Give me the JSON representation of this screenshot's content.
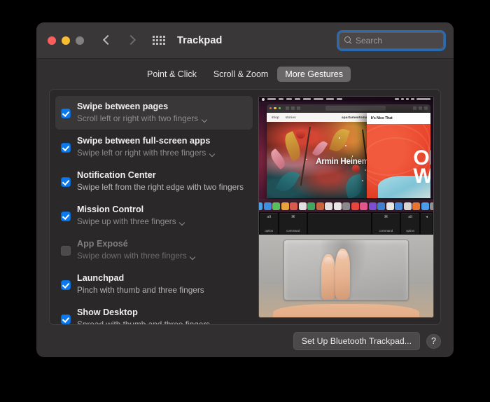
{
  "window": {
    "title": "Trackpad",
    "traffic_lights": [
      "close",
      "minimize",
      "zoom"
    ],
    "nav_back": "back",
    "nav_forward": "forward",
    "grid_button": "show-all-preferences"
  },
  "search": {
    "placeholder": "Search",
    "value": "",
    "icon": "search-icon",
    "focused": true,
    "focus_ring_color": "#2a6ab0"
  },
  "tabs": [
    {
      "label": "Point & Click",
      "active": false
    },
    {
      "label": "Scroll & Zoom",
      "active": false
    },
    {
      "label": "More Gestures",
      "active": true
    }
  ],
  "gestures": [
    {
      "title": "Swipe between pages",
      "subtitle": "Scroll left or right with two fingers",
      "checked": true,
      "has_popup": true,
      "selected": true,
      "enabled": true
    },
    {
      "title": "Swipe between full-screen apps",
      "subtitle": "Swipe left or right with three fingers",
      "checked": true,
      "has_popup": true,
      "selected": false,
      "enabled": true
    },
    {
      "title": "Notification Center",
      "subtitle": "Swipe left from the right edge with two fingers",
      "checked": true,
      "has_popup": false,
      "selected": false,
      "enabled": true
    },
    {
      "title": "Mission Control",
      "subtitle": "Swipe up with three fingers",
      "checked": true,
      "has_popup": true,
      "selected": false,
      "enabled": true
    },
    {
      "title": "App Exposé",
      "subtitle": "Swipe down with three fingers",
      "checked": false,
      "has_popup": true,
      "selected": false,
      "enabled": false
    },
    {
      "title": "Launchpad",
      "subtitle": "Pinch with thumb and three fingers",
      "checked": true,
      "has_popup": false,
      "selected": false,
      "enabled": true
    },
    {
      "title": "Show Desktop",
      "subtitle": "Spread with thumb and three fingers",
      "checked": true,
      "has_popup": false,
      "selected": false,
      "enabled": true
    }
  ],
  "preview": {
    "name": "gesture-demo-video",
    "top_scene": "macOS desktop with Safari showing a dark floral page",
    "bottom_scene": "MacBook keyboard and trackpad with two fingers swiping",
    "safari_nav_links": [
      "shop",
      "stories"
    ],
    "safari_site_title": "apartamentomagazine.com",
    "safari_headline": "Armin Heinema",
    "right_page_logo": "It's Nice That",
    "right_page_text": [
      "OI",
      "W"
    ],
    "keys": [
      {
        "glyph": "alt",
        "label": "option"
      },
      {
        "glyph": "⌘",
        "label": "command"
      },
      {
        "glyph": "",
        "label": ""
      },
      {
        "glyph": "⌘",
        "label": "command"
      },
      {
        "glyph": "alt",
        "label": "option"
      },
      {
        "glyph": "◂",
        "label": ""
      }
    ],
    "dock_colors": [
      "#3a7fd5",
      "#e8e6e3",
      "#4aa3e8",
      "#3f8fe0",
      "#58c05a",
      "#e8a33d",
      "#d85a4a",
      "#e0e0de",
      "#3fa85f",
      "#c8643c",
      "#e0dfdd",
      "#e9e7e4",
      "#8a8a8a",
      "#e8453c",
      "#e0558a",
      "#7b4fd0",
      "#3f7fd0",
      "#e8e6e3",
      "#4d8fd8",
      "#d8d6d3",
      "#e8742f",
      "#4a9ee8",
      "#8f8f8f",
      "#3f86d8",
      "#8a8a8a"
    ]
  },
  "footer": {
    "setup_button": "Set Up Bluetooth Trackpad...",
    "help_button": "?"
  },
  "colors": {
    "accent_blue": "#0a79ef",
    "window_bg": "#322f31",
    "titlebar_bg": "#3a3739",
    "panel_bg": "#2b282a",
    "selected_row": "#3a3739"
  }
}
